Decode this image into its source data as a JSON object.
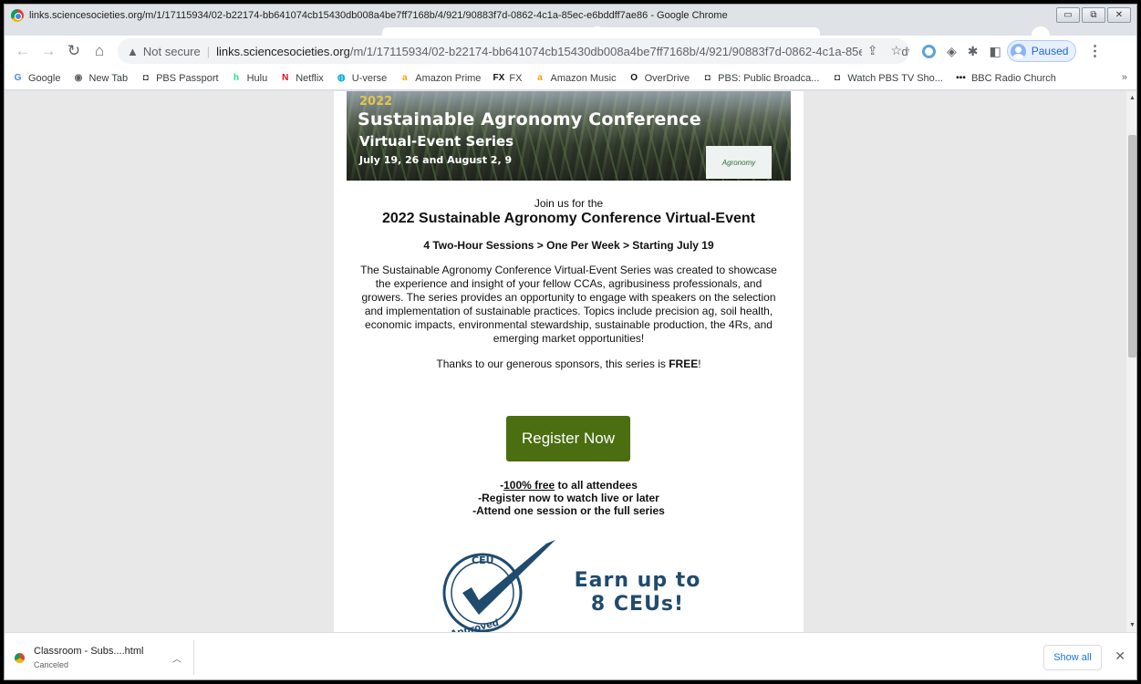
{
  "window": {
    "title": "links.sciencesocieties.org/m/1/17115934/02-b22174-bb641074cb15430db008a4be7ff7168b/4/921/90883f7d-0862-4c1a-85ec-e6bddff7ae86 - Google Chrome",
    "controls": [
      "▭",
      "⧉",
      "✕"
    ]
  },
  "address_bar": {
    "security": "Not secure",
    "host": "links.sciencesocieties.org",
    "path": "/m/1/17115934/02-b22174-bb641074cb15430db008a4be7ff7168b/4/921/90883f7d-0862-4c1a-85ec-e6bddff7a...",
    "profile_status": "Paused"
  },
  "bookmarks": [
    {
      "label": "Google",
      "icon": "google-icon",
      "glyph": "G",
      "color": "#4285f4"
    },
    {
      "label": "New Tab",
      "icon": "globe-icon",
      "glyph": "◉",
      "color": "#5f6368"
    },
    {
      "label": "PBS Passport",
      "icon": "pbs-icon",
      "glyph": "◘",
      "color": "#2b2b2b"
    },
    {
      "label": "Hulu",
      "icon": "hulu-icon",
      "glyph": "h",
      "color": "#1ce783"
    },
    {
      "label": "Netflix",
      "icon": "netflix-icon",
      "glyph": "N",
      "color": "#e50914"
    },
    {
      "label": "U-verse",
      "icon": "att-icon",
      "glyph": "◍",
      "color": "#00a8e0"
    },
    {
      "label": "Amazon Prime",
      "icon": "amazon-icon",
      "glyph": "a",
      "color": "#ff9900"
    },
    {
      "label": "FX",
      "icon": "fx-icon",
      "glyph": "FX",
      "color": "#111111"
    },
    {
      "label": "Amazon Music",
      "icon": "amazon-icon",
      "glyph": "a",
      "color": "#ff9900"
    },
    {
      "label": "OverDrive",
      "icon": "overdrive-icon",
      "glyph": "O",
      "color": "#111111"
    },
    {
      "label": "PBS: Public Broadca...",
      "icon": "pbs-icon",
      "glyph": "◘",
      "color": "#2b2b2b"
    },
    {
      "label": "Watch PBS TV Sho...",
      "icon": "pbs-icon",
      "glyph": "◘",
      "color": "#2b2b2b"
    },
    {
      "label": "BBC Radio Church",
      "icon": "bbc-icon",
      "glyph": "▪▪▪",
      "color": "#111111"
    }
  ],
  "bookmarks_more": "»",
  "banner": {
    "year": "2022",
    "title": "Sustainable Agronomy Conference",
    "subtitle": "Virtual-Event Series",
    "dates": "July 19, 26 and August 2, 9",
    "logo_text": "Agronomy"
  },
  "email": {
    "join": "Join us for the",
    "heading": "2022 Sustainable Agronomy Conference Virtual-Event",
    "sessions": "4 Two-Hour Sessions > One Per Week > Starting July 19",
    "description": "The Sustainable Agronomy Conference Virtual-Event Series was created to showcase the experience and insight of your fellow CCAs, agribusiness professionals, and growers. The series provides an opportunity to engage with speakers on the selection and implementation of sustainable practices. Topics include precision ag, soil health, economic impacts, environmental stewardship, sustainable production, the 4Rs, and emerging market opportunities!",
    "thanks_prefix": "Thanks to our generous sponsors, this series is ",
    "thanks_bold": "FREE",
    "thanks_suffix": "!",
    "register_label": "Register Now",
    "perk1_dash": "-",
    "perk1_underlined": "100% free",
    "perk1_rest": " to all attendees",
    "perk2": "-Register now to watch live or later",
    "perk3": "-Attend one session or the full series",
    "ceu_top": "CEU",
    "ceu_bottom": "Approved",
    "earn_line1": "Earn up to",
    "earn_line2": "8 CEUs!"
  },
  "download": {
    "filename": "Classroom - Subs....html",
    "status": "Canceled",
    "show_all": "Show all"
  },
  "colors": {
    "register_button": "#4a6e10",
    "ceu_blue": "#1f4b6e",
    "banner_year": "#e8c44a"
  }
}
